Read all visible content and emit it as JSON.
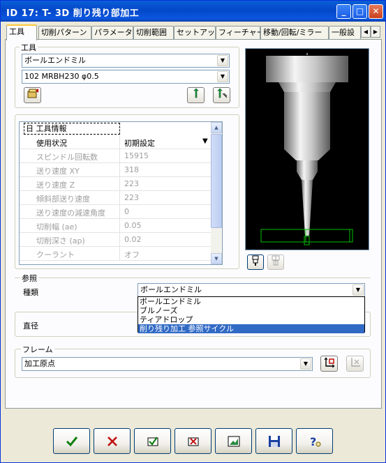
{
  "window": {
    "title": "ID 17: T- 3D 削り残り部加工"
  },
  "titlebar_buttons": {
    "minimize": "_",
    "maximize": "□",
    "close": "✕"
  },
  "tabs": [
    {
      "label": "工具"
    },
    {
      "label": "切削パターン"
    },
    {
      "label": "パラメータ"
    },
    {
      "label": "切削範囲"
    },
    {
      "label": "セットアップ"
    },
    {
      "label": "フィーチャー"
    },
    {
      "label": "移動/回転/ミラー"
    },
    {
      "label": "一般設"
    }
  ],
  "tool_group": {
    "legend": "工具",
    "tool_type": "ボールエンドミル",
    "tool_name": "102   MRBH230   φ0.5"
  },
  "properties": {
    "header": "日 工具情報",
    "rows": [
      {
        "key": "使用状況",
        "value": "初期設定"
      },
      {
        "key": "スピンドル回転数",
        "value": "15915"
      },
      {
        "key": "送り速度 XY",
        "value": "318"
      },
      {
        "key": "送り速度 Z",
        "value": "223"
      },
      {
        "key": "傾斜部送り速度",
        "value": "223"
      },
      {
        "key": "送り速度の減速角度",
        "value": "0"
      },
      {
        "key": "切削幅 (ae)",
        "value": "0.05"
      },
      {
        "key": "切削深さ (ap)",
        "value": "0.02"
      },
      {
        "key": "クーラント",
        "value": "オフ"
      }
    ]
  },
  "reference_group": {
    "legend": "参照",
    "type_label": "種類",
    "type_value": "ボールエンドミル",
    "options": [
      "ボールエンドミル",
      "ブルノーズ",
      "ティアドロップ",
      "削り残り加工  参照サイクル"
    ],
    "selected_index": 3,
    "diameter_label": "直径"
  },
  "frame_group": {
    "legend": "フレーム",
    "value": "加工原点"
  },
  "colors": {
    "accent": "#316ac5",
    "titlebar": "#0348c8",
    "tool_outline": "#00c000"
  }
}
